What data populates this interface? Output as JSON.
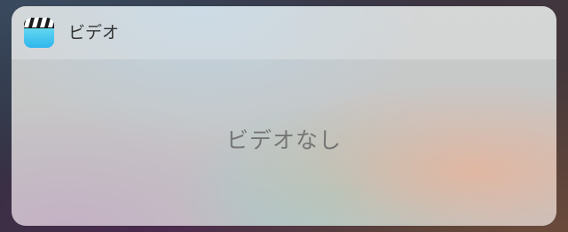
{
  "widget": {
    "app_name": "ビデオ",
    "app_icon": "videos-clapperboard-icon",
    "empty_message": "ビデオなし"
  },
  "colors": {
    "icon_gradient_top": "#7ee8f0",
    "icon_gradient_bottom": "#2fb6ee",
    "title_text": "#333333",
    "message_text": "#757575"
  }
}
